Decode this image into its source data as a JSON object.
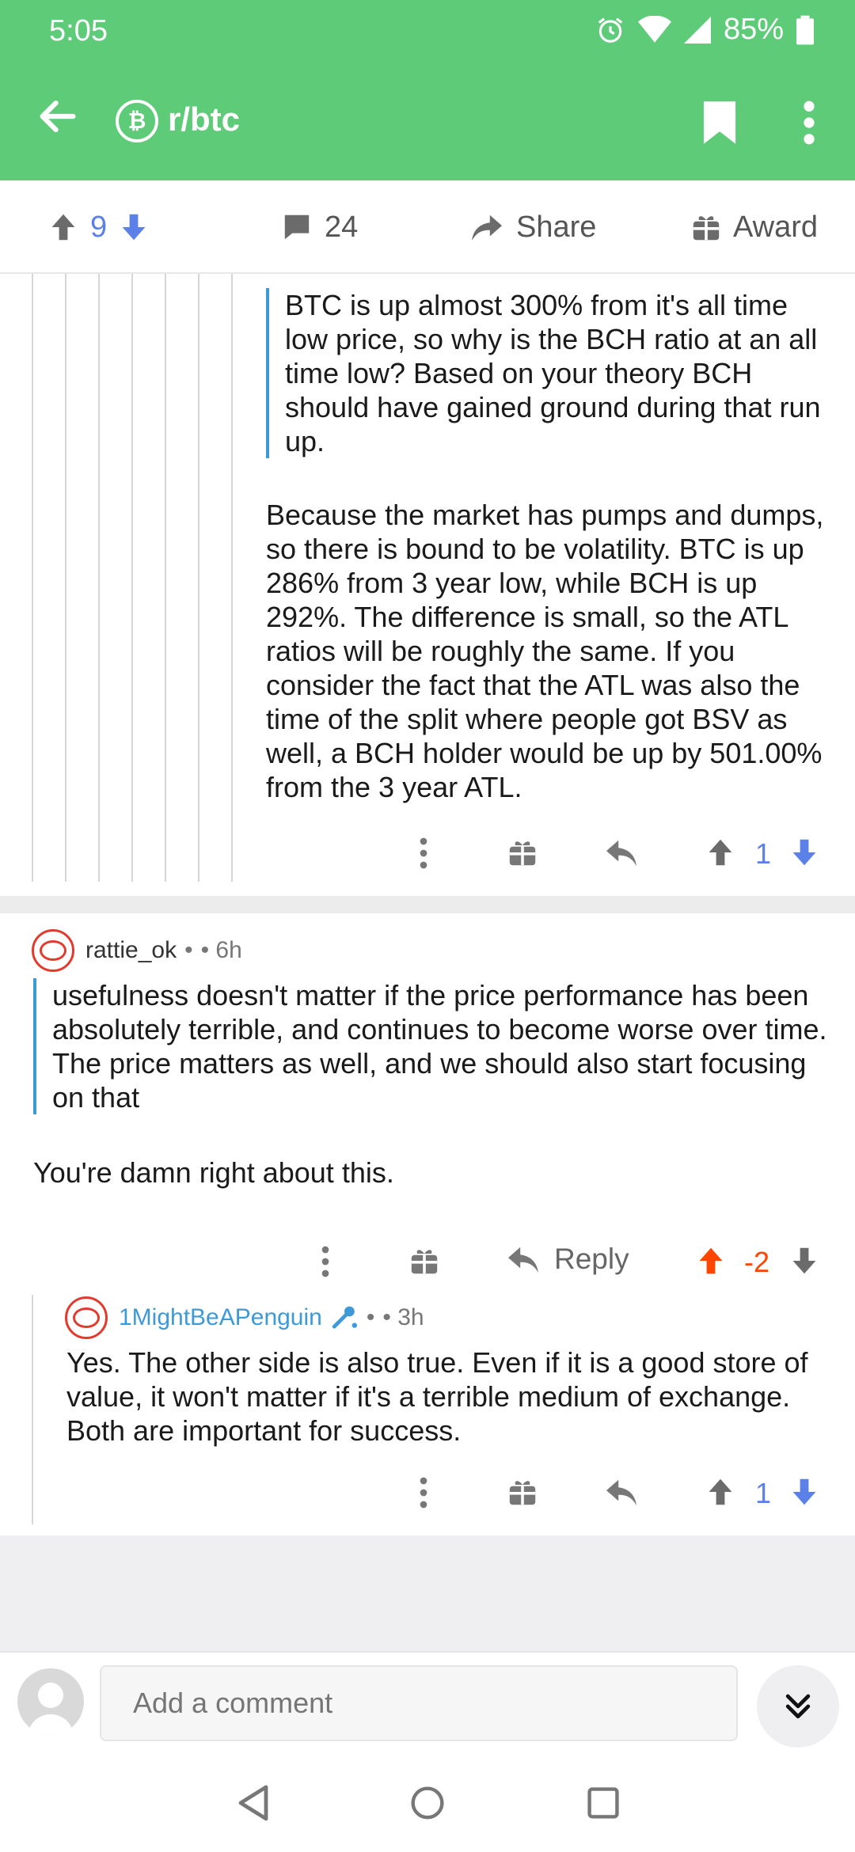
{
  "status_bar": {
    "time": "5:05",
    "battery": "85%"
  },
  "app_bar": {
    "subreddit": "r/btc",
    "subreddit_icon": "bitcoin-icon"
  },
  "post_actions": {
    "upvotes": "9",
    "comments": "24",
    "share_label": "Share",
    "award_label": "Award"
  },
  "comments": [
    {
      "quote": "BTC is up almost 300% from it's all time low price, so why is the BCH ratio at an all time low? Based on your theory BCH should have gained ground during that run up.",
      "body": "Because the market has pumps and dumps, so there is bound to be volatility. BTC is up 286% from 3 year low, while BCH is up 292%. The difference is small, so the ATL ratios will be roughly the same. If you consider the fact that the ATL was also the time of the split where people got BSV as well, a BCH holder would be up by 501.00% from the 3 year ATL.",
      "score": "1"
    },
    {
      "username": "rattie_ok",
      "separator": "•",
      "time": "• 6h",
      "quote": "usefulness doesn't matter if the price performance has been absolutely terrible, and continues to become worse over time. The price matters as well, and we should also start focusing on that",
      "body": "You're damn right about this.",
      "reply_label": "Reply",
      "score": "-2"
    },
    {
      "username": "1MightBeAPenguin",
      "separator": "•",
      "time": "• 3h",
      "body": "Yes. The other side is also true. Even if it is a good store of value, it won't matter if it's a terrible medium of exchange. Both are important for success.",
      "score": "1"
    }
  ],
  "composer": {
    "placeholder": "Add a comment"
  },
  "colors": {
    "header": "#5ecb78",
    "upvote_active": "#ff4500",
    "vote_blue": "#5b80e8",
    "quote_bar": "#3d9ad9",
    "link_blue": "#3d9ad9"
  }
}
